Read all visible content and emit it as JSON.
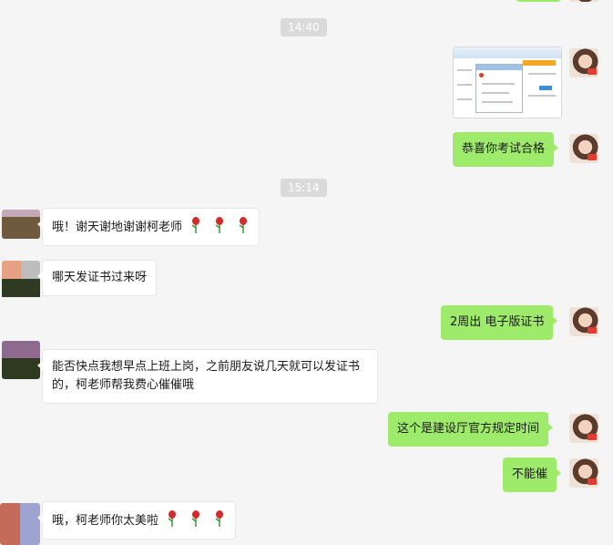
{
  "timestamps": [
    "14:40",
    "15:14"
  ],
  "messages": [
    {
      "side": "right",
      "type": "image",
      "alt": ""
    },
    {
      "side": "right",
      "type": "text",
      "text": "恭喜你考试合格"
    },
    {
      "side": "left",
      "type": "text",
      "text": "哦！谢天谢地谢谢柯老师",
      "emoji": [
        "rose",
        "rose",
        "rose"
      ]
    },
    {
      "side": "left",
      "type": "text",
      "text": "哪天发证书过来呀"
    },
    {
      "side": "right",
      "type": "text",
      "text": "2周出 电子版证书"
    },
    {
      "side": "left",
      "type": "text",
      "text": "能否快点我想早点上班上岗，之前朋友说几天就可以发证书的，柯老师帮我费心催催哦"
    },
    {
      "side": "right",
      "type": "text",
      "text": "这个是建设厅官方规定时间"
    },
    {
      "side": "right",
      "type": "text",
      "text": "不能催"
    },
    {
      "side": "left",
      "type": "text",
      "text": "哦，柯老师你太美啦",
      "emoji": [
        "rose",
        "rose",
        "rose"
      ]
    }
  ],
  "colors": {
    "background": "#f5f5f5",
    "sent_bubble": "#9eea6a",
    "received_bubble": "#ffffff",
    "timestamp_pill": "#dadada"
  }
}
